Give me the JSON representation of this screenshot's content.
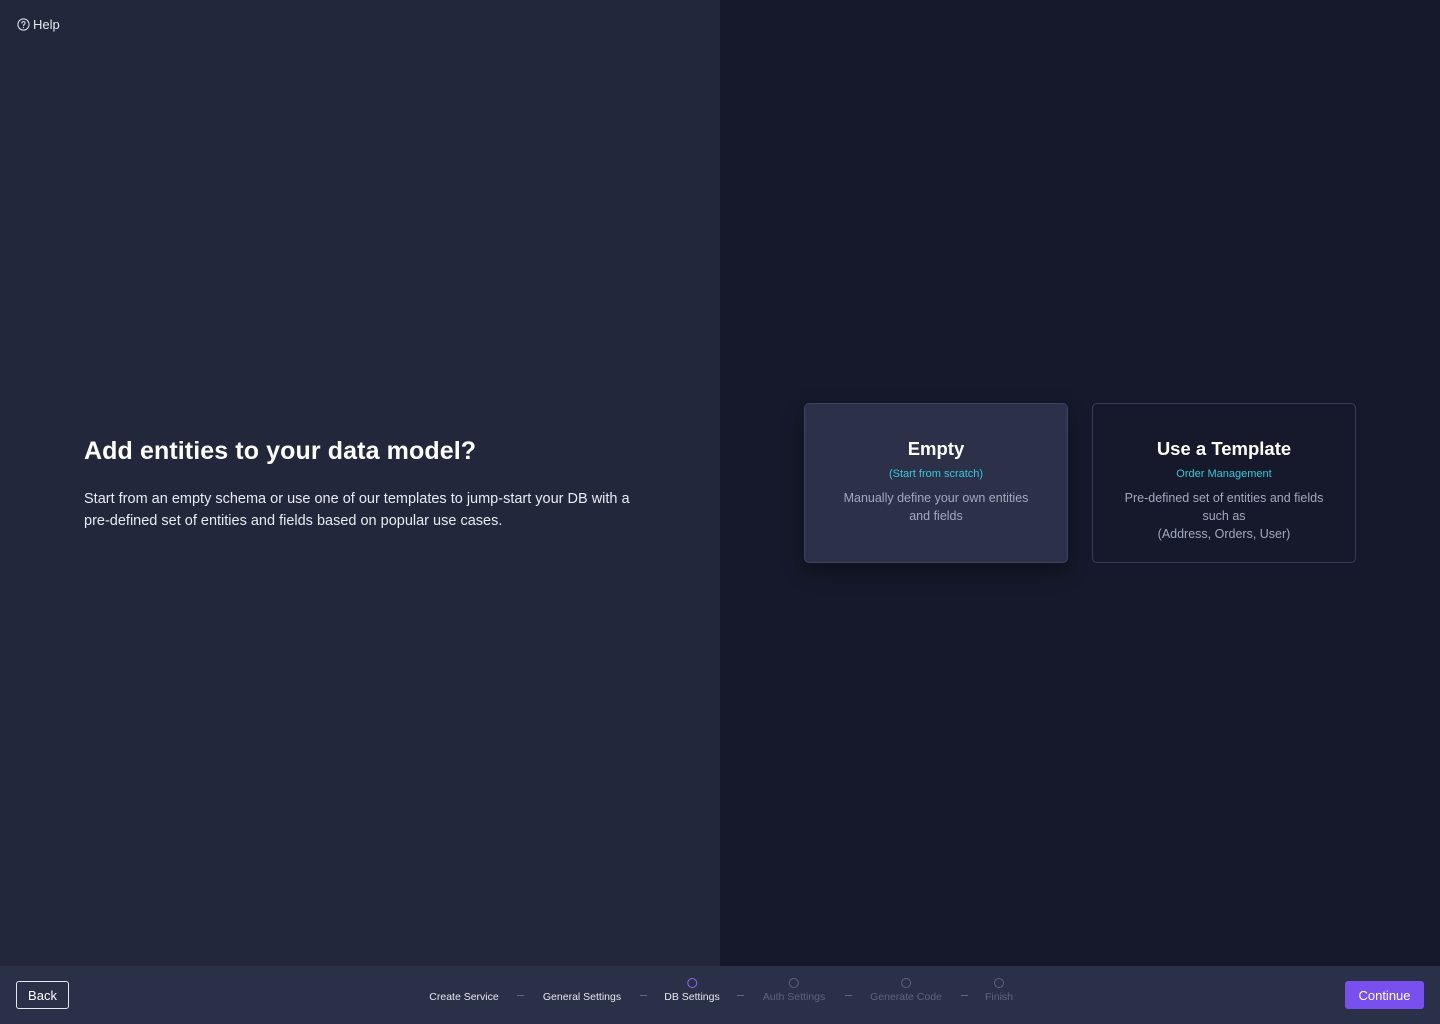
{
  "help": {
    "label": "Help"
  },
  "main": {
    "title": "Add entities to your data model?",
    "description": "Start from an empty schema or use one of our templates to jump-start your DB with a pre-defined set of entities and fields based on popular use cases."
  },
  "options": [
    {
      "title": "Empty",
      "subtitle": "(Start from scratch)",
      "description_lines": [
        "Manually define your own entities",
        "and fields"
      ],
      "selected": true
    },
    {
      "title": "Use a Template",
      "subtitle": "Order Management",
      "description_lines": [
        "Pre-defined set of entities and fields",
        "such as",
        "(Address, Orders, User)"
      ],
      "selected": false
    }
  ],
  "footer": {
    "back_label": "Back",
    "continue_label": "Continue",
    "steps": [
      {
        "label": "Create Service",
        "state": "done"
      },
      {
        "label": "General Settings",
        "state": "done"
      },
      {
        "label": "DB Settings",
        "state": "active"
      },
      {
        "label": "Auth Settings",
        "state": "pending"
      },
      {
        "label": "Generate Code",
        "state": "pending"
      },
      {
        "label": "Finish",
        "state": "pending"
      }
    ]
  },
  "colors": {
    "accent": "#7950ed",
    "subtitle": "#37c8d8",
    "left_panel": "#22273b",
    "right_panel": "#15192b",
    "footer": "#2b3049"
  },
  "icons": {
    "help": "help-circle-icon",
    "step_done": "check-icon",
    "step_active": "circle-icon",
    "step_pending": "circle-icon"
  }
}
